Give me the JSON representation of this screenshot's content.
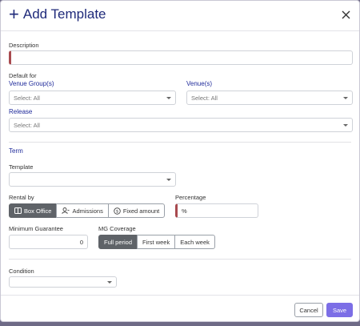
{
  "dialog": {
    "title": "Add Template",
    "icons": {
      "add": "plus-icon",
      "close": "close-icon"
    }
  },
  "description": {
    "label": "Description",
    "value": ""
  },
  "default_for": {
    "label": "Default for",
    "venue_groups": {
      "label": "Venue Group(s)",
      "value": "Select: All"
    },
    "venues": {
      "label": "Venue(s)",
      "value": "Select: All"
    },
    "release": {
      "label": "Release",
      "value": "Select: All"
    }
  },
  "term": {
    "section_title": "Term",
    "template": {
      "label": "Template",
      "value": ""
    },
    "rental_by": {
      "label": "Rental by",
      "options": [
        {
          "label": "Box Office",
          "icon": "ticket-icon",
          "selected": true
        },
        {
          "label": "Admissions",
          "icon": "person-icon",
          "selected": false
        },
        {
          "label": "Fixed amount",
          "icon": "dollar-circle-icon",
          "selected": false
        }
      ]
    },
    "percentage": {
      "label": "Percentage",
      "value": "%"
    },
    "minimum_guarantee": {
      "label": "Minimum Guarantee",
      "value": "0"
    },
    "mg_coverage": {
      "label": "MG Coverage",
      "options": [
        {
          "label": "Full period",
          "selected": true
        },
        {
          "label": "First week",
          "selected": false
        },
        {
          "label": "Each week",
          "selected": false
        }
      ]
    }
  },
  "condition": {
    "label": "Condition",
    "value": ""
  },
  "footer": {
    "cancel_label": "Cancel",
    "save_label": "Save"
  },
  "colors": {
    "title": "#1f2a7a",
    "required_marker": "#a84a4f",
    "segment_active": "#5f6368",
    "save_button": "#7c6ee6",
    "backdrop": "#6e6a86"
  }
}
